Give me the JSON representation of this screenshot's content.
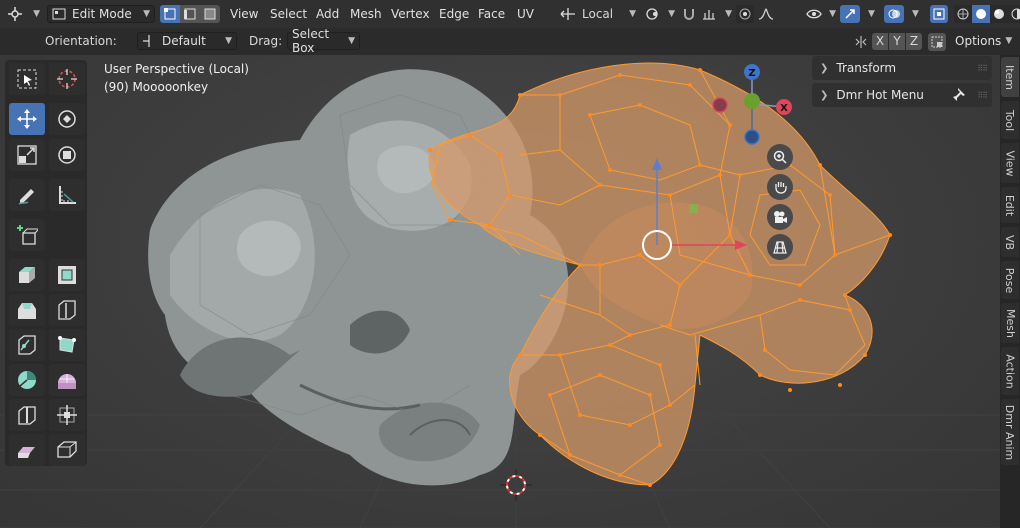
{
  "header": {
    "mode": "Edit Mode",
    "menus": [
      "View",
      "Select",
      "Add",
      "Mesh",
      "Vertex",
      "Edge",
      "Face",
      "UV"
    ],
    "transform_orientation": "Local",
    "options_label": "Options"
  },
  "subheader": {
    "orientation_label": "Orientation:",
    "orientation_value": "Default",
    "drag_label": "Drag:",
    "drag_value": "Select Box",
    "axis": [
      "X",
      "Y",
      "Z"
    ]
  },
  "viewport": {
    "view_name": "User Perspective (Local)",
    "object_info": "(90) Mooooonkey",
    "gizmo": {
      "z": "Z",
      "x": "X"
    }
  },
  "npanel": {
    "panels": [
      "Transform",
      "Dmr Hot Menu"
    ]
  },
  "tabs": [
    "Item",
    "Tool",
    "View",
    "Edit",
    "VB",
    "Pose",
    "Mesh",
    "Action",
    "Dmr Anim"
  ],
  "colors": {
    "accent": "#4772b3",
    "selection": "#ff8a1f",
    "header": "#303030"
  }
}
